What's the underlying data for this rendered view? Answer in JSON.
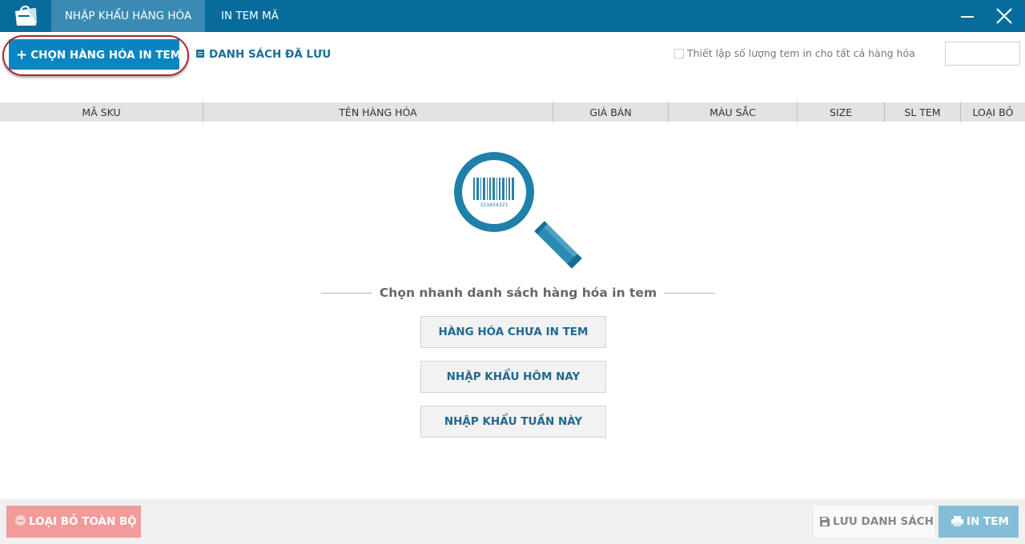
{
  "window": {
    "tabs": [
      {
        "label": "NHẬP KHẨU HÀNG HÓA",
        "active": true
      },
      {
        "label": "IN TEM MÃ",
        "active": false
      }
    ],
    "colors": {
      "titlebar": "#076c9c",
      "accent": "#0a85c2",
      "active_tab": "#3b8ab3"
    }
  },
  "toolbar": {
    "choose_label": "CHỌN HÀNG HÓA IN TEM",
    "saved_list_label": "DANH SÁCH ĐÃ LƯU",
    "set_qty_label": "Thiết lập số lượng tem in cho tất cả hàng hóa",
    "set_qty_checked": false,
    "qty_value": ""
  },
  "table": {
    "columns": [
      "MÃ SKU",
      "TÊN HÀNG HÓA",
      "GIÁ BÁN",
      "MÀU SẮC",
      "SIZE",
      "SL TEM",
      "LOẠI BỎ"
    ]
  },
  "empty_state": {
    "barcode_number": "321654321",
    "quick_title": "Chọn nhanh danh sách hàng hóa in tem",
    "quick_buttons": [
      "HÀNG HÓA CHƯA IN TEM",
      "NHẬP KHẨU HÔM NAY",
      "NHẬP KHẨU TUẦN NÀY"
    ]
  },
  "footer": {
    "remove_all_label": "LOẠI BỎ TOÀN BỘ",
    "save_list_label": "LƯU DANH SÁCH",
    "print_label": "IN TEM"
  },
  "icons": {
    "logo": "shopping-bag-icon",
    "minimize": "minimize-icon",
    "close": "close-icon",
    "saved_list": "list-icon",
    "search_barcode": "magnifier-barcode-icon",
    "remove_all": "minus-circle-icon",
    "save": "floppy-disk-icon",
    "print": "printer-icon"
  }
}
